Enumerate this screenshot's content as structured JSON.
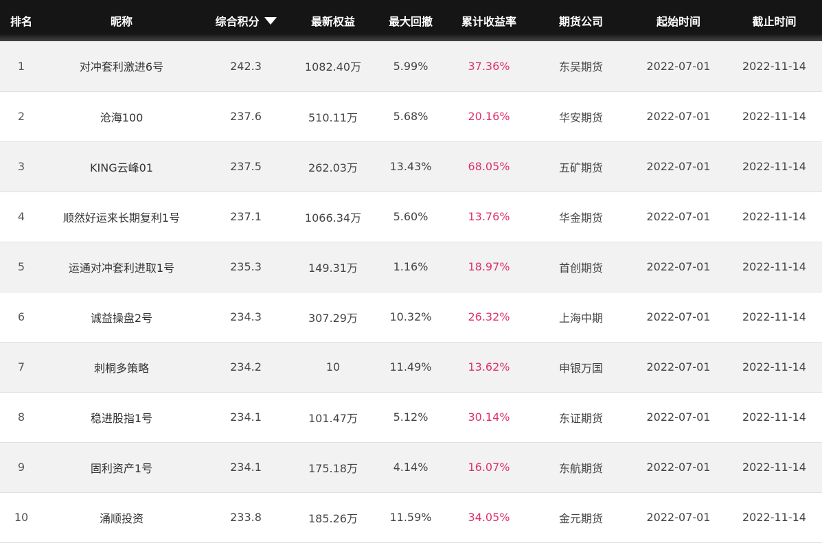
{
  "colors": {
    "header_bg": "#151515",
    "header_text": "#ffffff",
    "return_text": "#e0306a",
    "row_alt": "#f2f2f2"
  },
  "header": {
    "rank": "排名",
    "name": "昵称",
    "score": "综合积分",
    "score_sort_icon": "sort-desc-icon",
    "equity": "最新权益",
    "drawdown": "最大回撤",
    "return": "累计收益率",
    "company": "期货公司",
    "start": "起始时间",
    "end": "截止时间"
  },
  "rows": [
    {
      "rank": "1",
      "name": "对冲套利激进6号",
      "score": "242.3",
      "equity": "1082.40万",
      "drawdown": "5.99%",
      "return": "37.36%",
      "company": "东吴期货",
      "start": "2022-07-01",
      "end": "2022-11-14"
    },
    {
      "rank": "2",
      "name": "沧海100",
      "score": "237.6",
      "equity": "510.11万",
      "drawdown": "5.68%",
      "return": "20.16%",
      "company": "华安期货",
      "start": "2022-07-01",
      "end": "2022-11-14"
    },
    {
      "rank": "3",
      "name": "KING云峰01",
      "score": "237.5",
      "equity": "262.03万",
      "drawdown": "13.43%",
      "return": "68.05%",
      "company": "五矿期货",
      "start": "2022-07-01",
      "end": "2022-11-14"
    },
    {
      "rank": "4",
      "name": "顺然好运来长期复利1号",
      "score": "237.1",
      "equity": "1066.34万",
      "drawdown": "5.60%",
      "return": "13.76%",
      "company": "华金期货",
      "start": "2022-07-01",
      "end": "2022-11-14"
    },
    {
      "rank": "5",
      "name": "运通对冲套利进取1号",
      "score": "235.3",
      "equity": "149.31万",
      "drawdown": "1.16%",
      "return": "18.97%",
      "company": "首创期货",
      "start": "2022-07-01",
      "end": "2022-11-14"
    },
    {
      "rank": "6",
      "name": "诚益操盘2号",
      "score": "234.3",
      "equity": "307.29万",
      "drawdown": "10.32%",
      "return": "26.32%",
      "company": "上海中期",
      "start": "2022-07-01",
      "end": "2022-11-14"
    },
    {
      "rank": "7",
      "name": "刺桐多策略",
      "score": "234.2",
      "equity": "10",
      "drawdown": "11.49%",
      "return": "13.62%",
      "company": "申银万国",
      "start": "2022-07-01",
      "end": "2022-11-14"
    },
    {
      "rank": "8",
      "name": "稳进股指1号",
      "score": "234.1",
      "equity": "101.47万",
      "drawdown": "5.12%",
      "return": "30.14%",
      "company": "东证期货",
      "start": "2022-07-01",
      "end": "2022-11-14"
    },
    {
      "rank": "9",
      "name": "固利资产1号",
      "score": "234.1",
      "equity": "175.18万",
      "drawdown": "4.14%",
      "return": "16.07%",
      "company": "东航期货",
      "start": "2022-07-01",
      "end": "2022-11-14"
    },
    {
      "rank": "10",
      "name": "涌顺投资",
      "score": "233.8",
      "equity": "185.26万",
      "drawdown": "11.59%",
      "return": "34.05%",
      "company": "金元期货",
      "start": "2022-07-01",
      "end": "2022-11-14"
    }
  ]
}
